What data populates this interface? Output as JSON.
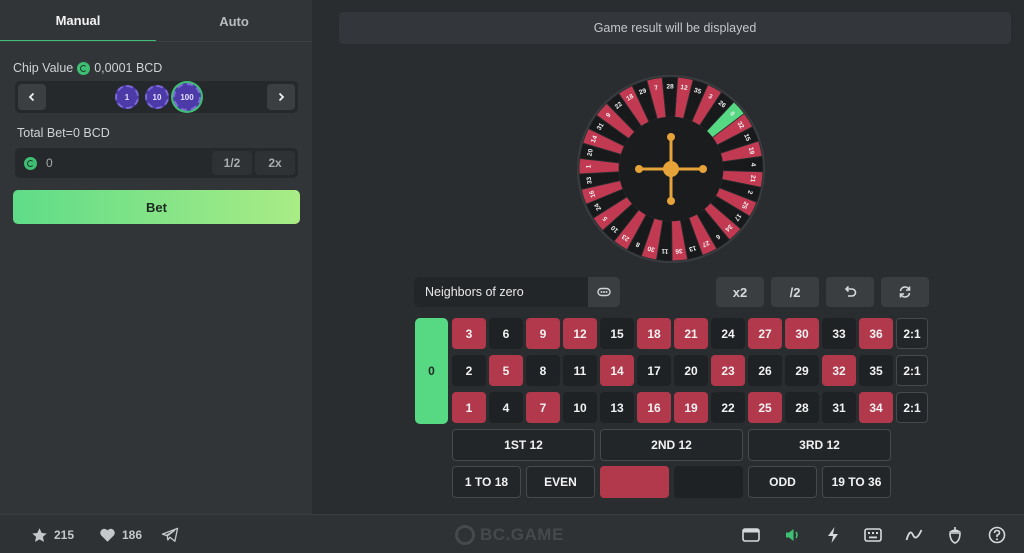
{
  "tabs": {
    "manual": "Manual",
    "auto": "Auto"
  },
  "chip_value": {
    "label": "Chip Value",
    "amount": "0,0001 BCD"
  },
  "chips": [
    "1",
    "10",
    "100"
  ],
  "total_bet": {
    "label": "Total Bet=0 BCD",
    "value": "0",
    "half": "1/2",
    "double": "2x"
  },
  "bet_button": "Bet",
  "result_text": "Game result will be displayed",
  "wheel_numbers": [
    "0",
    "32",
    "15",
    "19",
    "4",
    "21",
    "2",
    "25",
    "17",
    "34",
    "6",
    "27",
    "13",
    "36",
    "11",
    "30",
    "8",
    "23",
    "10",
    "5",
    "24",
    "16",
    "33",
    "1",
    "20",
    "14",
    "31",
    "9",
    "22",
    "18",
    "29",
    "7",
    "28",
    "12",
    "35",
    "3",
    "26"
  ],
  "red_numbers": [
    "1",
    "3",
    "5",
    "7",
    "9",
    "12",
    "14",
    "16",
    "18",
    "19",
    "21",
    "23",
    "25",
    "27",
    "30",
    "32",
    "34",
    "36"
  ],
  "neighbors_label": "Neighbors of zero",
  "controls": {
    "x2": "x2",
    "half": "/2"
  },
  "table": {
    "zero": "0",
    "rows": [
      [
        "3",
        "6",
        "9",
        "12",
        "15",
        "18",
        "21",
        "24",
        "27",
        "30",
        "33",
        "36"
      ],
      [
        "2",
        "5",
        "8",
        "11",
        "14",
        "17",
        "20",
        "23",
        "26",
        "29",
        "32",
        "35"
      ],
      [
        "1",
        "4",
        "7",
        "10",
        "13",
        "16",
        "19",
        "22",
        "25",
        "28",
        "31",
        "34"
      ]
    ],
    "column_bets": [
      "2:1",
      "2:1",
      "2:1"
    ],
    "dozens": [
      "1ST 12",
      "2ND 12",
      "3RD 12"
    ],
    "outside": {
      "low": "1 TO 18",
      "even": "EVEN",
      "odd": "ODD",
      "high": "19 TO 36"
    }
  },
  "footer": {
    "stars": "215",
    "likes": "186",
    "logo": "BC.GAME"
  },
  "colors": {
    "accent": "#3fbf73",
    "red": "#b2384c",
    "black": "#1f2224",
    "zero": "#57d984"
  }
}
